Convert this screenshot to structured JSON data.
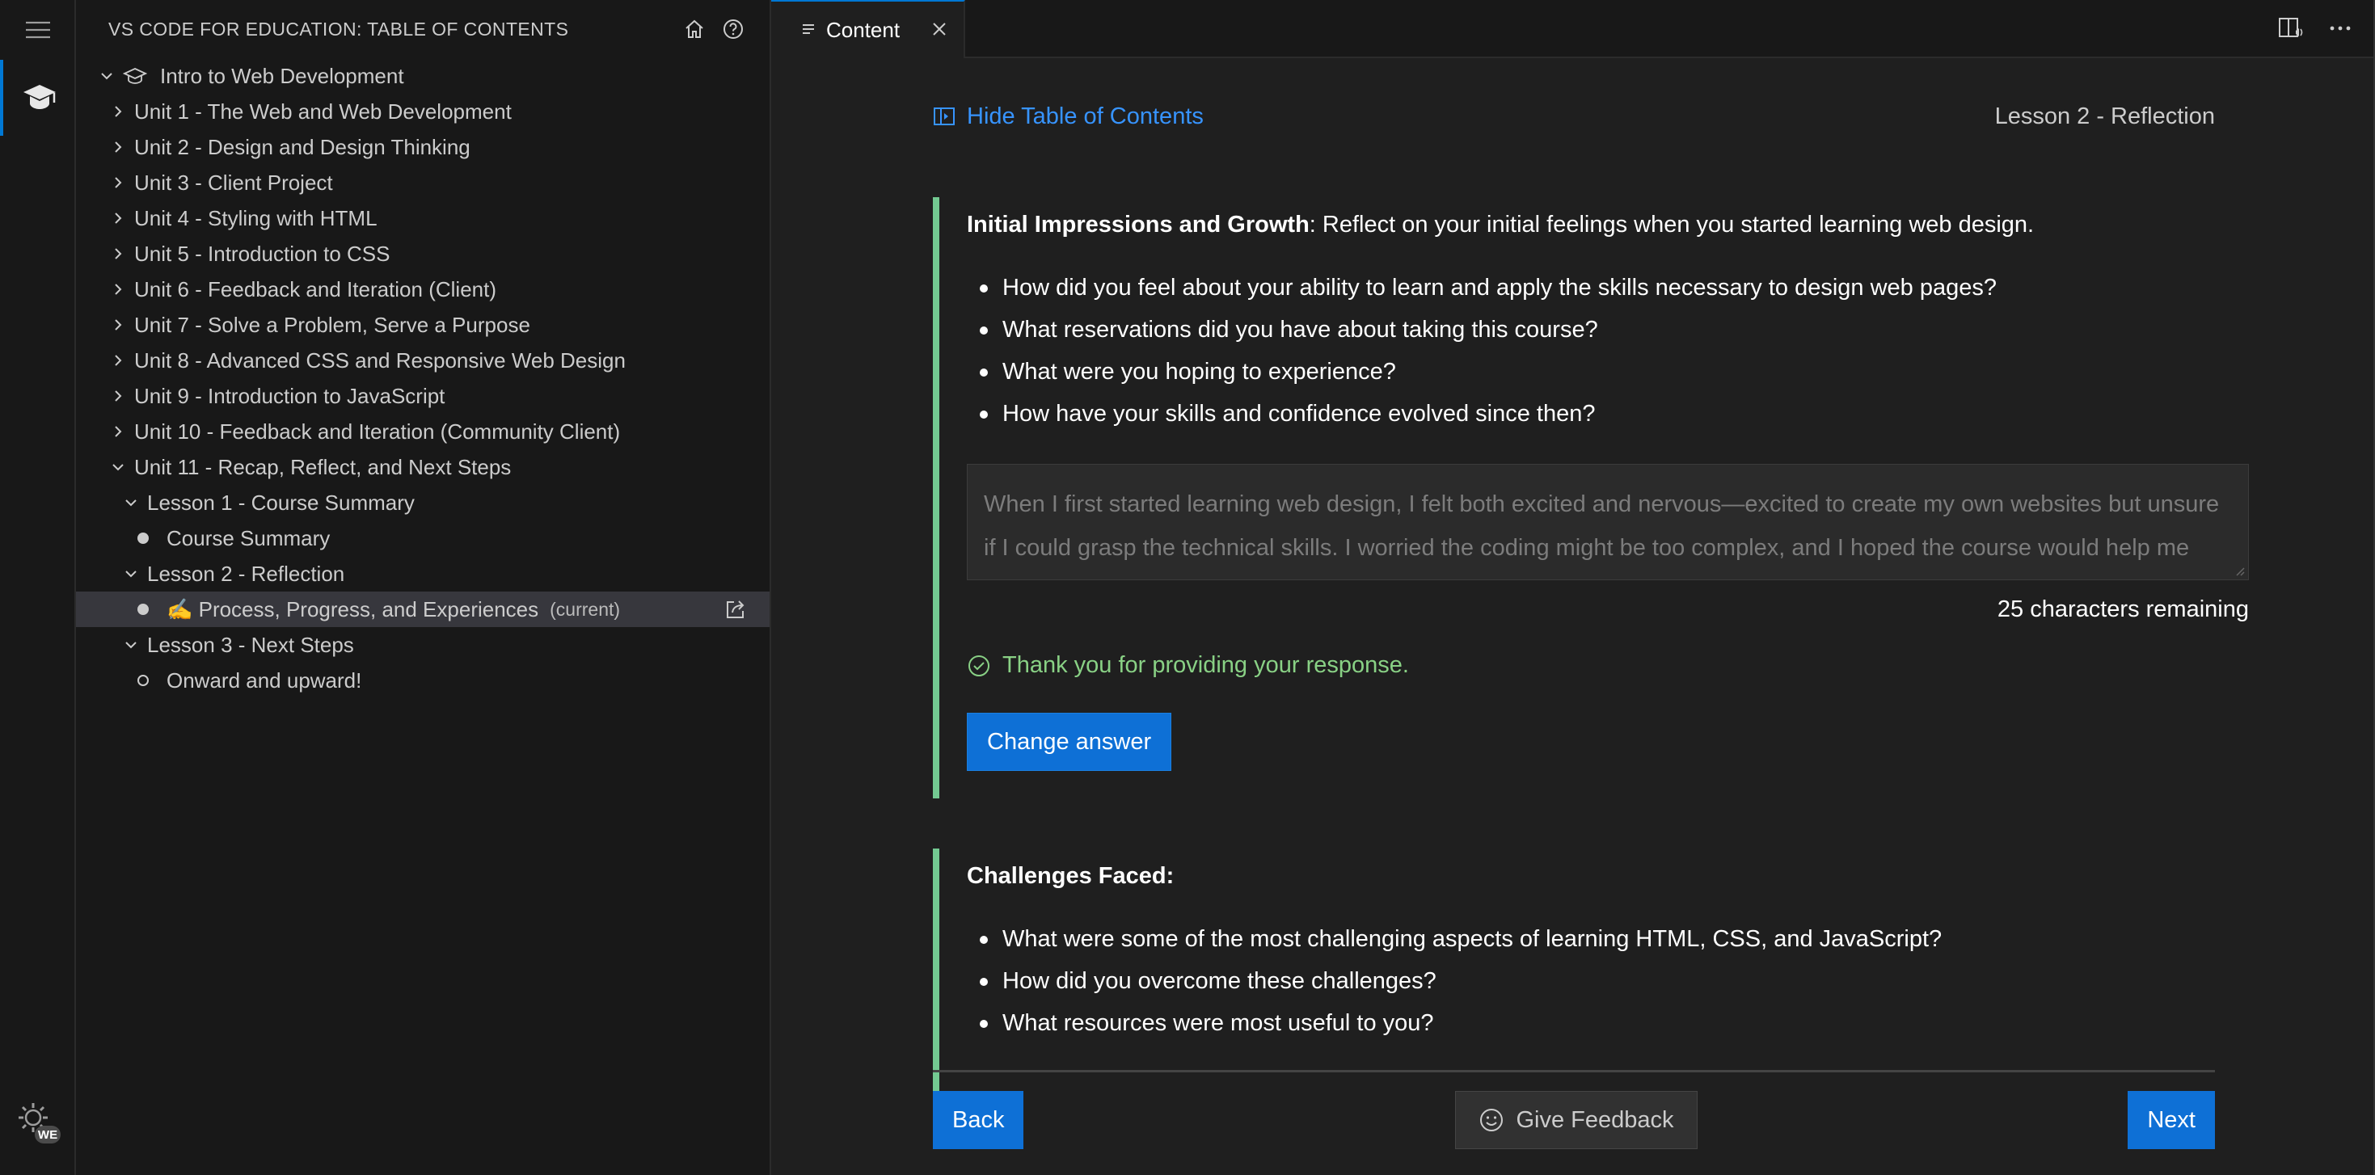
{
  "activity_bar": {
    "menu_icon": "hamburger-menu-icon",
    "edu_icon": "graduation-cap-icon",
    "account_icon": "gear-icon",
    "account_badge": "WE"
  },
  "sidebar": {
    "title": "VS CODE FOR EDUCATION: TABLE OF CONTENTS",
    "actions": [
      "home-icon",
      "help-icon"
    ],
    "course": "Intro to Web Development",
    "units": [
      "Unit 1 - The Web and Web Development",
      "Unit 2 - Design and Design Thinking",
      "Unit 3 - Client Project",
      "Unit 4 - Styling with HTML",
      "Unit 5 - Introduction to CSS",
      "Unit 6 - Feedback and Iteration (Client)",
      "Unit 7 - Solve a Problem, Serve a Purpose",
      "Unit 8 - Advanced CSS and Responsive Web Design",
      "Unit 9 - Introduction to JavaScript",
      "Unit 10 - Feedback and Iteration (Community Client)",
      "Unit 11 - Recap, Reflect, and Next Steps"
    ],
    "lessons": {
      "lesson1": "Lesson 1 - Course Summary",
      "lesson1_item": "Course Summary",
      "lesson2": "Lesson 2 - Reflection",
      "lesson2_item": "✍️ Process, Progress, and Experiences",
      "current_tag": "(current)",
      "lesson3": "Lesson 3 - Next Steps",
      "lesson3_item": "Onward and upward!"
    }
  },
  "editor": {
    "tab_label": "Content",
    "hide_toc": "Hide Table of Contents",
    "lesson_title": "Lesson 2 - Reflection",
    "section1": {
      "heading_bold": "Initial Impressions and Growth",
      "heading_rest": ": Reflect on your initial feelings when you started learning web design.",
      "questions": [
        "How did you feel about your ability to learn and apply the skills necessary to design web pages?",
        "What reservations did you have about taking this course?",
        "What were you hoping to experience?",
        "How have your skills and confidence evolved since then?"
      ],
      "answer": "When I first started learning web design, I felt both excited and nervous—excited to create my own websites but unsure if I could grasp the technical skills. I worried the coding might be too complex, and I hoped the course would help me build skills and confidence through hands-on practice.",
      "remaining": "25 characters remaining",
      "thanks": "Thank you for providing your response.",
      "change_answer": "Change answer"
    },
    "section2": {
      "heading_bold": "Challenges Faced:",
      "questions": [
        "What were some of the most challenging aspects of learning HTML, CSS, and JavaScript?",
        "How did you overcome these challenges?",
        "What resources were most useful to you?"
      ]
    },
    "footer": {
      "back": "Back",
      "feedback": "Give Feedback",
      "next": "Next"
    }
  },
  "colors": {
    "accent": "#0e70d6",
    "link": "#3794ff",
    "success": "#89d185",
    "block_border": "#73c991"
  }
}
